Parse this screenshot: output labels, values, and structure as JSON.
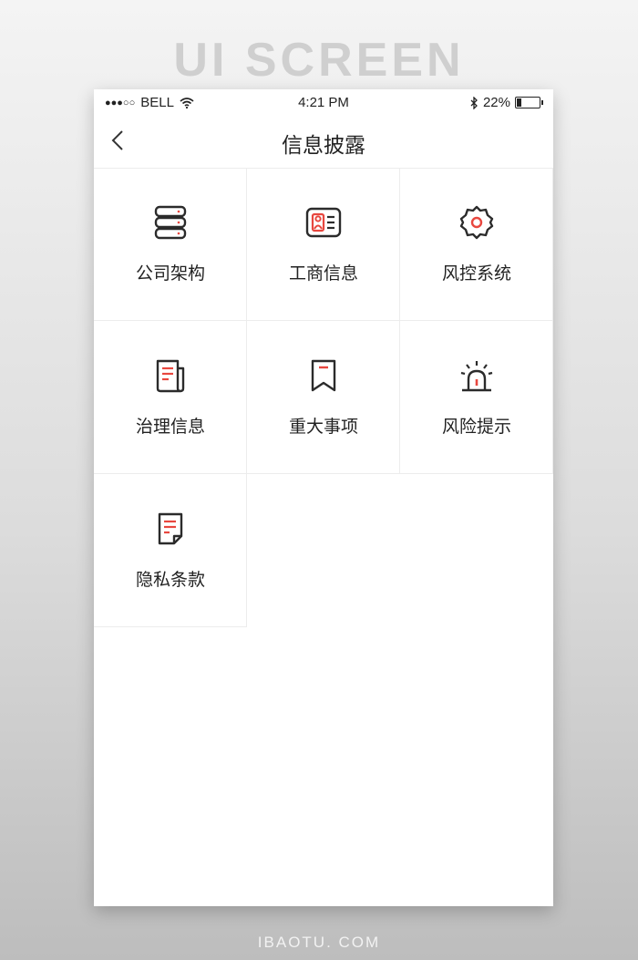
{
  "banner": {
    "text": "UI SCREEN"
  },
  "footer": {
    "text": "IBAOTU. COM"
  },
  "status_bar": {
    "signal": "●●●○○",
    "carrier": "BELL",
    "time": "4:21 PM",
    "battery": "22%",
    "battery_level_percent": 22
  },
  "nav": {
    "title": "信息披露",
    "back_icon": "chevron-left-icon"
  },
  "grid_items": [
    {
      "label": "公司架构",
      "icon": "server-stack-icon"
    },
    {
      "label": "工商信息",
      "icon": "id-card-icon"
    },
    {
      "label": "风控系统",
      "icon": "gear-icon"
    },
    {
      "label": "治理信息",
      "icon": "newspaper-icon"
    },
    {
      "label": "重大事项",
      "icon": "bookmark-icon"
    },
    {
      "label": "风险提示",
      "icon": "alarm-light-icon"
    },
    {
      "label": "隐私条款",
      "icon": "document-icon"
    }
  ],
  "colors": {
    "accent": "#e8473f",
    "icon_stroke": "#2b2b2b",
    "divider": "#ececec",
    "text": "#222222"
  }
}
